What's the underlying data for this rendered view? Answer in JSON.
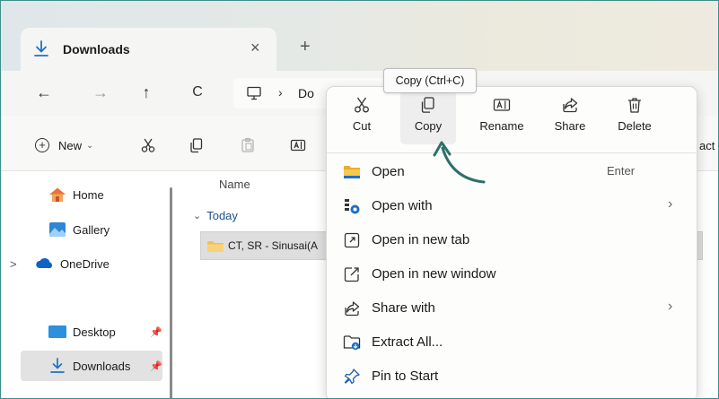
{
  "window": {
    "tab": {
      "title": "Downloads",
      "close_glyph": "×",
      "new_tab_glyph": "+",
      "icon": "download-icon"
    }
  },
  "nav": {
    "back": "←",
    "forward": "→",
    "up": "↑",
    "refresh": "C",
    "address": {
      "chevron": "›",
      "text": "Do",
      "icon": "this-pc-icon"
    }
  },
  "toolbar": {
    "new_label": "New",
    "new_chevron": "⌄",
    "new_plus": "+",
    "right_label": "act"
  },
  "sidebar": {
    "items": [
      {
        "label": "Home",
        "icon": "home-icon"
      },
      {
        "label": "Gallery",
        "icon": "gallery-icon"
      },
      {
        "label": "OneDrive",
        "icon": "onedrive-icon",
        "expand": ">"
      },
      {
        "label": "Desktop",
        "icon": "desktop-icon",
        "pin": "📌"
      },
      {
        "label": "Downloads",
        "icon": "download-icon",
        "pin": "📌"
      }
    ]
  },
  "filelist": {
    "column_name": "Name",
    "group": {
      "chevron": "⌄",
      "label": "Today"
    },
    "file": {
      "name": "CT, SR - Sinusai(A",
      "icon": "folder-icon"
    }
  },
  "tooltip": {
    "text": "Copy (Ctrl+C)"
  },
  "context_menu": {
    "quick_actions": [
      {
        "label": "Cut",
        "icon": "cut-icon"
      },
      {
        "label": "Copy",
        "icon": "copy-icon"
      },
      {
        "label": "Rename",
        "icon": "rename-icon"
      },
      {
        "label": "Share",
        "icon": "share-icon"
      },
      {
        "label": "Delete",
        "icon": "delete-icon"
      }
    ],
    "items": [
      {
        "label": "Open",
        "key": "Enter",
        "icon": "folder-icon"
      },
      {
        "label": "Open with",
        "arrow": "›",
        "icon": "open-with-icon"
      },
      {
        "label": "Open in new tab",
        "icon": "new-tab-icon"
      },
      {
        "label": "Open in new window",
        "icon": "new-window-icon"
      },
      {
        "label": "Share with",
        "arrow": "›",
        "icon": "share-icon"
      },
      {
        "label": "Extract All...",
        "icon": "extract-icon"
      },
      {
        "label": "Pin to Start",
        "icon": "pin-icon"
      }
    ]
  },
  "colors": {
    "frame_border": "#3f8f8a",
    "annotation_arrow": "#2f6f6a",
    "folder": "#f2c14e",
    "accent_blue": "#0f6cbd"
  }
}
